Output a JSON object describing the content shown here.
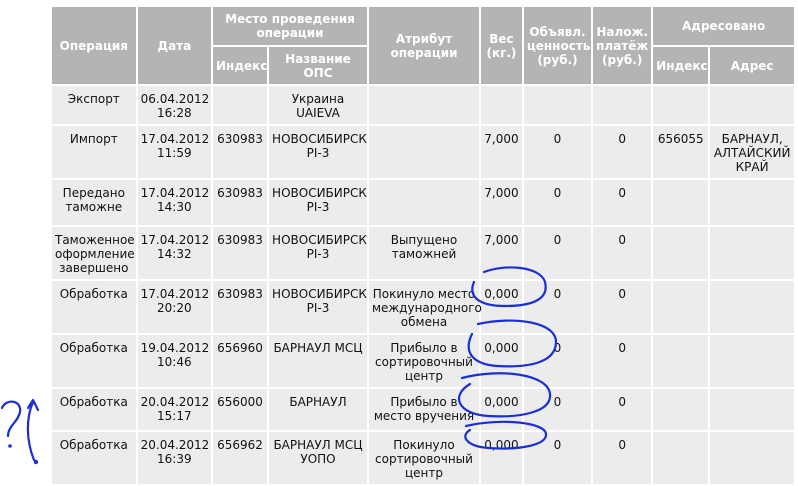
{
  "table": {
    "headers": {
      "operation": "Операция",
      "date": "Дата",
      "place": "Место проведения операции",
      "attribute": "Атрибут операции",
      "weight": "Вес (кг.)",
      "declared_value": "Объявл. ценность (руб.)",
      "cod": "Налож. платёж (руб.)",
      "addressed": "Адресовано",
      "place_index": "Индекс",
      "place_name": "Название ОПС",
      "addr_index": "Индекс",
      "addr_address": "Адрес"
    },
    "rows": [
      {
        "operation": "Экспорт",
        "date": "06.04.2012 16:28",
        "index": "",
        "ops": "Украина UAIEVA",
        "attribute": "",
        "weight": "",
        "value": "",
        "cod": "",
        "addr_index": "",
        "address": ""
      },
      {
        "operation": "Импорт",
        "date": "17.04.2012 11:59",
        "index": "630983",
        "ops": "НОВОСИБИРСК PI-3",
        "attribute": "",
        "weight": "7,000",
        "value": "0",
        "cod": "0",
        "addr_index": "656055",
        "address": "БАРНАУЛ, АЛТАЙСКИЙ КРАЙ"
      },
      {
        "operation": "Передано таможне",
        "date": "17.04.2012 14:30",
        "index": "630983",
        "ops": "НОВОСИБИРСК PI-3",
        "attribute": "",
        "weight": "7,000",
        "value": "0",
        "cod": "0",
        "addr_index": "",
        "address": ""
      },
      {
        "operation": "Таможенное оформление завершено",
        "date": "17.04.2012 14:32",
        "index": "630983",
        "ops": "НОВОСИБИРСК PI-3",
        "attribute": "Выпущено таможней",
        "weight": "7,000",
        "value": "0",
        "cod": "0",
        "addr_index": "",
        "address": ""
      },
      {
        "operation": "Обработка",
        "date": "17.04.2012 20:20",
        "index": "630983",
        "ops": "НОВОСИБИРСК PI-3",
        "attribute": "Покинуло место международного обмена",
        "weight": "0,000",
        "value": "0",
        "cod": "0",
        "addr_index": "",
        "address": ""
      },
      {
        "operation": "Обработка",
        "date": "19.04.2012 10:46",
        "index": "656960",
        "ops": "БАРНАУЛ МСЦ",
        "attribute": "Прибыло в сортировочный центр",
        "weight": "0,000",
        "value": "0",
        "cod": "0",
        "addr_index": "",
        "address": ""
      },
      {
        "operation": "Обработка",
        "date": "20.04.2012 15:17",
        "index": "656000",
        "ops": "БАРНАУЛ",
        "attribute": "Прибыло в место вручения",
        "weight": "0,000",
        "value": "0",
        "cod": "0",
        "addr_index": "",
        "address": ""
      },
      {
        "operation": "Обработка",
        "date": "20.04.2012 16:39",
        "index": "656962",
        "ops": "БАРНАУЛ МСЦ УОПО",
        "attribute": "Покинуло сортировочный центр",
        "weight": "0,000",
        "value": "0",
        "cod": "0",
        "addr_index": "",
        "address": ""
      }
    ]
  },
  "annotation": {
    "color": "#1a2fd6",
    "marks": "?!"
  }
}
